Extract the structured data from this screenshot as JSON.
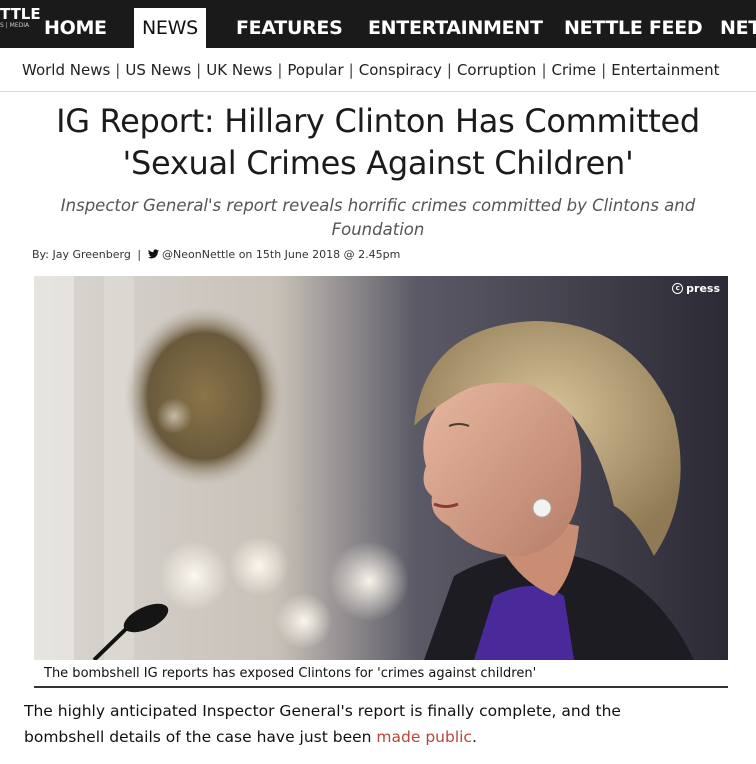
{
  "nav": {
    "logo_main": "TTLE",
    "logo_sub": "S | MEDIA",
    "items": [
      "HOME",
      "NEWS",
      "FEATURES",
      "ENTERTAINMENT",
      "NETTLE FEED",
      "NET"
    ],
    "active": "NEWS"
  },
  "subnav": {
    "items": [
      "World News",
      "US News",
      "UK News",
      "Popular",
      "Conspiracy",
      "Corruption",
      "Crime",
      "Entertainment"
    ]
  },
  "article": {
    "headline_line1": "IG Report: Hillary Clinton Has Committed",
    "headline_line2": "'Sexual Crimes Against Children'",
    "subhead_line1": "Inspector General's report reveals horrific crimes committed by Clintons and",
    "subhead_line2": "Foundation",
    "byline_prefix": "By: Jay Greenberg",
    "byline_sep": "|",
    "byline_handle": "@NeonNettle",
    "byline_date": "on 15th June 2018 @ 2.45pm",
    "image_credit": "press",
    "caption": "The bombshell IG reports has exposed Clintons for 'crimes against children'",
    "body_line1": "The highly anticipated Inspector General's report is finally complete, and the",
    "body_line2_prefix": "bombshell details of the case have just been ",
    "body_link": "made public",
    "body_line2_suffix": "."
  },
  "colors": {
    "nav_bg": "#1a1a1a",
    "link": "#b5473e",
    "subhead": "#555555"
  },
  "icons": {
    "twitter": "twitter-bird-icon",
    "credit": "copyright-icon"
  }
}
